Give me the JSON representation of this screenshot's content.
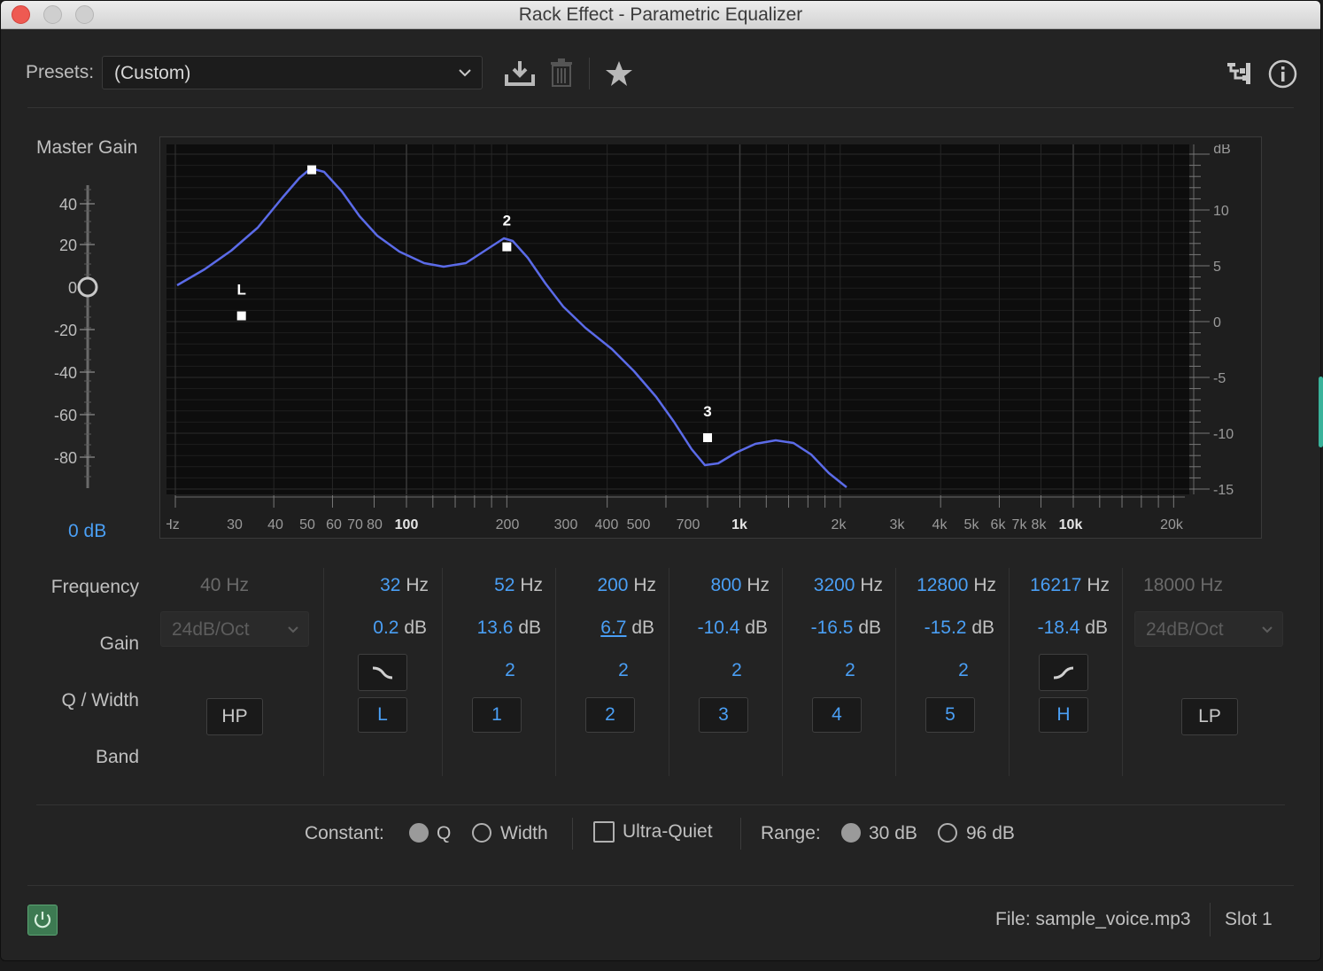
{
  "window": {
    "title": "Rack Effect - Parametric Equalizer"
  },
  "toolbar": {
    "presets_label": "Presets:",
    "presets_value": "(Custom)",
    "icons": [
      "save-preset-icon",
      "delete-preset-icon",
      "favorite-star-icon",
      "routing-icon",
      "info-icon"
    ]
  },
  "master_gain": {
    "label": "Master Gain",
    "ticks": [
      "40",
      "20",
      "0",
      "-20",
      "-40",
      "-60",
      "-80"
    ],
    "value": "0 dB",
    "value_db": 0
  },
  "graph": {
    "db_label": "dB",
    "db_ticks": [
      "10",
      "5",
      "0",
      "-5",
      "-10",
      "-15"
    ],
    "freq_labels": [
      "Hz",
      "30",
      "40",
      "50",
      "60",
      "70",
      "80",
      "100",
      "200",
      "300",
      "400",
      "500",
      "700",
      "1k",
      "2k",
      "3k",
      "4k",
      "5k",
      "6k",
      "7k",
      "8k",
      "10k",
      "20k"
    ],
    "bold_freq_labels": [
      "100",
      "1k",
      "10k"
    ],
    "curve_color": "#5b6be8",
    "markers": [
      {
        "label": "L",
        "freq_hz": 32,
        "gain_db": 0.2
      },
      {
        "label": "",
        "freq_hz": 52,
        "gain_db": 13.6
      },
      {
        "label": "2",
        "freq_hz": 200,
        "gain_db": 6.7
      },
      {
        "label": "3",
        "freq_hz": 800,
        "gain_db": -10.4
      }
    ]
  },
  "rows": {
    "frequency": "Frequency",
    "gain": "Gain",
    "q_width": "Q / Width",
    "band": "Band"
  },
  "hp": {
    "freq": "40",
    "unit": "Hz",
    "slope": "24dB/Oct",
    "button": "HP"
  },
  "lp": {
    "freq": "18000",
    "unit": "Hz",
    "slope": "24dB/Oct",
    "button": "LP"
  },
  "bands": [
    {
      "freq": "32",
      "gain": "0.2",
      "q": "",
      "button": "L",
      "shape": "low-shelf-icon"
    },
    {
      "freq": "52",
      "gain": "13.6",
      "q": "2",
      "button": "1"
    },
    {
      "freq": "200",
      "gain": "6.7",
      "q": "2",
      "button": "2"
    },
    {
      "freq": "800",
      "gain": "-10.4",
      "q": "2",
      "button": "3"
    },
    {
      "freq": "3200",
      "gain": "-16.5",
      "q": "2",
      "button": "4"
    },
    {
      "freq": "12800",
      "gain": "-15.2",
      "q": "2",
      "button": "5"
    },
    {
      "freq": "16217",
      "gain": "-18.4",
      "q": "",
      "button": "H",
      "shape": "high-shelf-icon"
    }
  ],
  "units": {
    "hz": "Hz",
    "db": "dB"
  },
  "options": {
    "constant_label": "Constant:",
    "q_label": "Q",
    "width_label": "Width",
    "ultra_quiet_label": "Ultra-Quiet",
    "range_label": "Range:",
    "range_30": "30 dB",
    "range_96": "96 dB",
    "constant_selected": "Q",
    "range_selected": "30 dB",
    "ultra_quiet_checked": false
  },
  "status": {
    "file": "File: sample_voice.mp3",
    "slot": "Slot 1",
    "power_on": true
  },
  "colors": {
    "accent": "#4a9ff5",
    "power": "#3d7a52",
    "background": "#232323"
  }
}
